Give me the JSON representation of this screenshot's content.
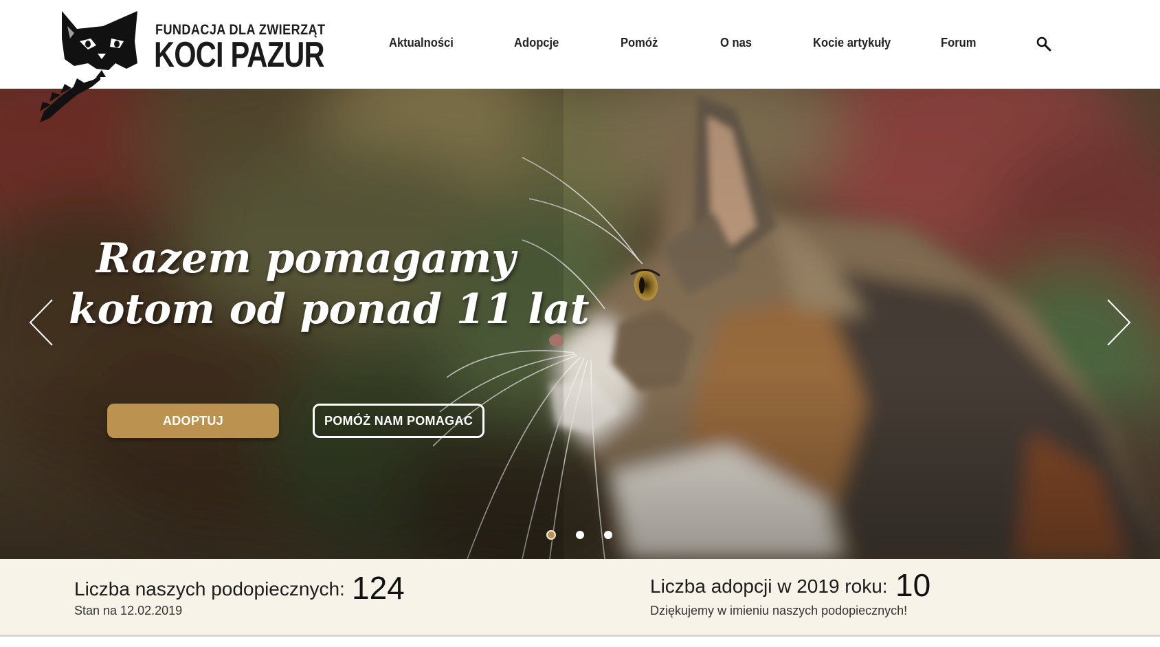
{
  "brand": {
    "line1": "FUNDACJA DLA ZWIERZĄT",
    "line2": "KOCI PAZUR"
  },
  "nav": {
    "items": [
      {
        "label": "Aktualności"
      },
      {
        "label": "Adopcje"
      },
      {
        "label": "Pomóż"
      },
      {
        "label": "O nas"
      },
      {
        "label": "Kocie artykuły"
      },
      {
        "label": "Forum"
      }
    ],
    "search_icon": "search-icon"
  },
  "hero": {
    "title_line1": "Razem pomagamy",
    "title_line2": "kotom od ponad 11 lat",
    "primary_button": "ADOPTUJ",
    "secondary_button": "POMÓŻ NAM POMAGAĆ",
    "slide_count": 3,
    "active_slide": 1,
    "prev_icon": "chevron-left-icon",
    "next_icon": "chevron-right-icon"
  },
  "stats": {
    "wards_label": "Liczba naszych podopiecznych:",
    "wards_value": "124",
    "wards_note": "Stan na 12.02.2019",
    "adoptions_label": "Liczba adopcji w 2019 roku:",
    "adoptions_value": "10",
    "adoptions_note": "Dziękujemy w imieniu naszych podopiecznych!"
  },
  "colors": {
    "accent": "#bb924f",
    "stats_background": "#f7f3e8",
    "text": "#111111"
  }
}
